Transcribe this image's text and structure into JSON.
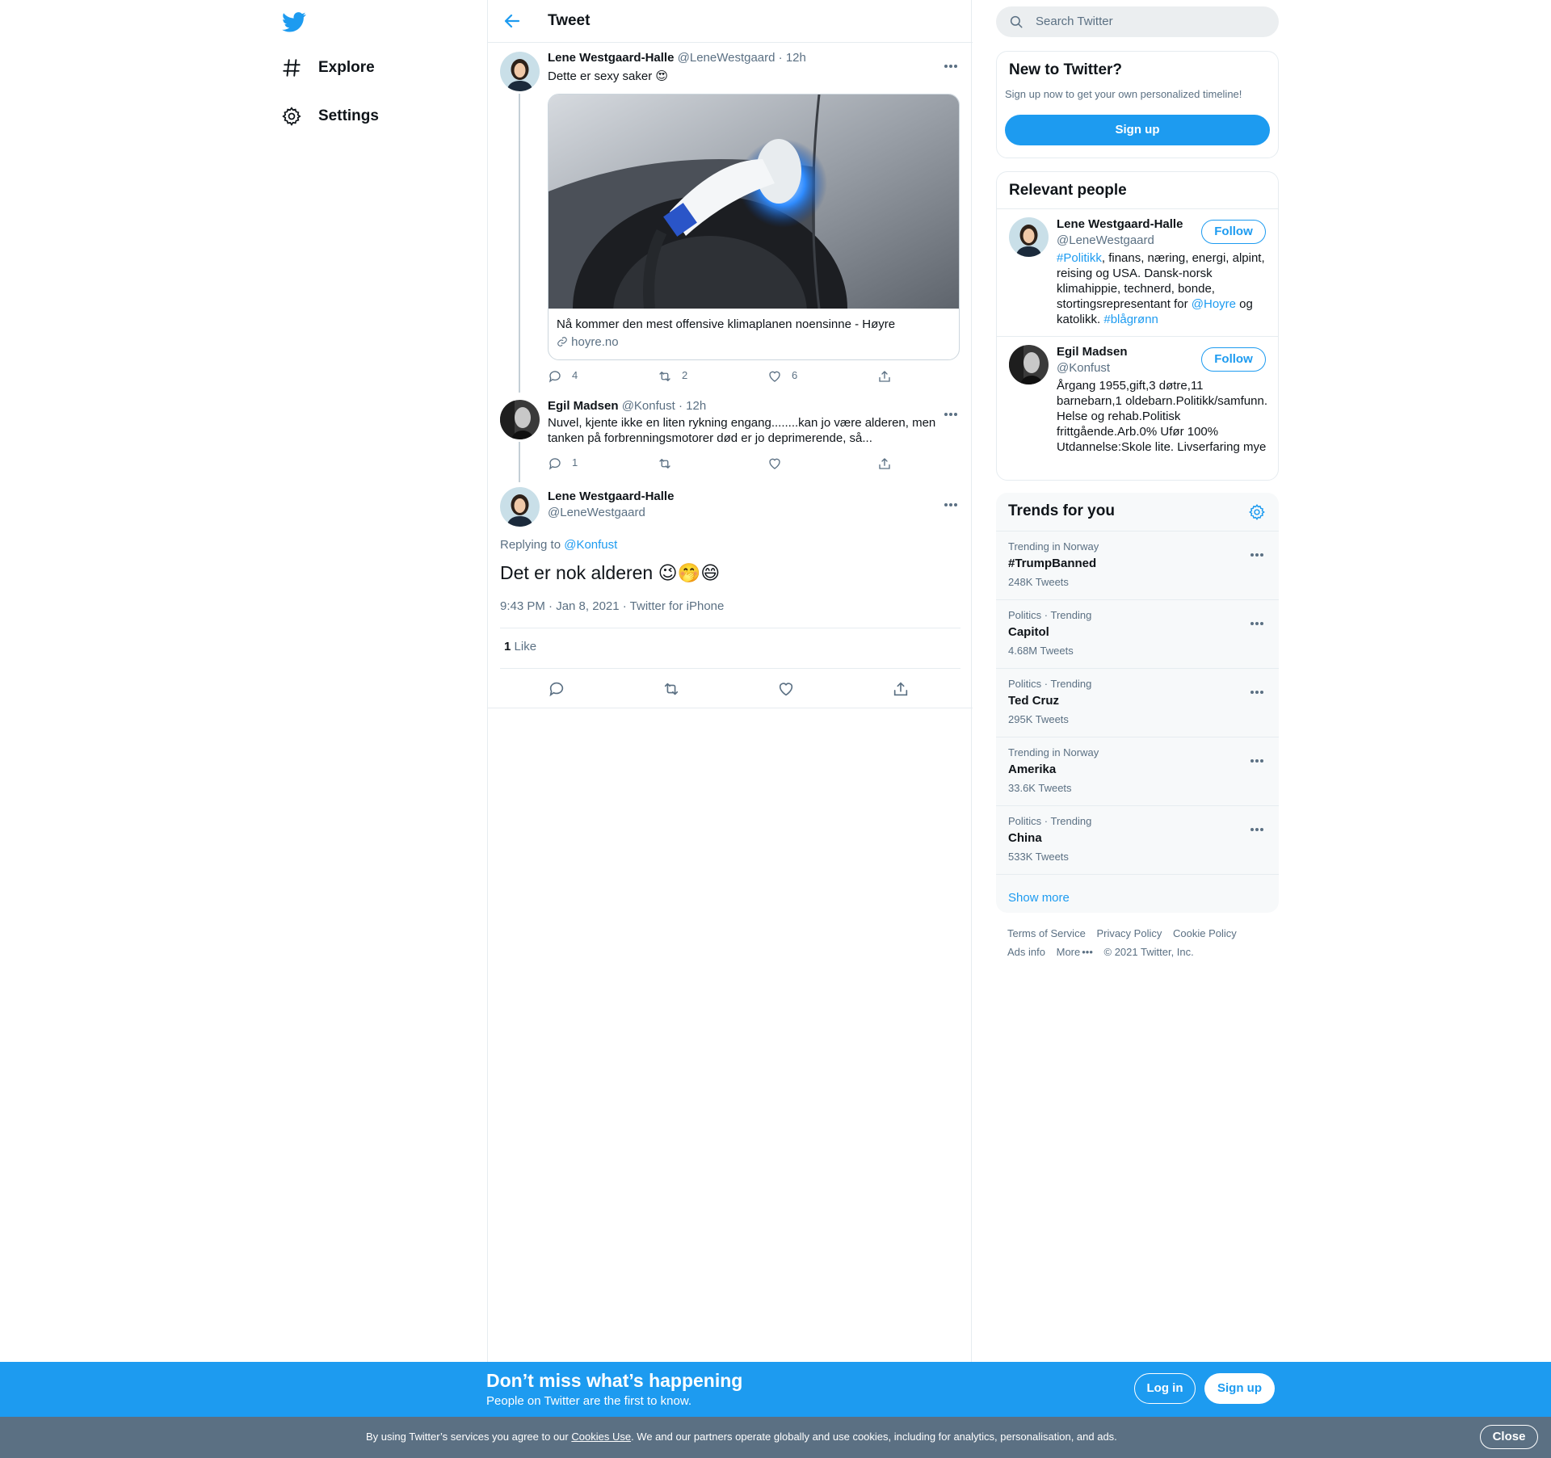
{
  "nav": {
    "explore_label": "Explore",
    "settings_label": "Settings"
  },
  "header": {
    "title": "Tweet"
  },
  "thread": [
    {
      "name": "Lene Westgaard-Halle",
      "handle": "@LeneWestgaard",
      "time": "· 12h",
      "text": "Dette er sexy saker",
      "emoji": "😍",
      "card": {
        "title": "Nå kommer den mest offensive klimaplanen noensinne - Høyre",
        "url": "hoyre.no"
      },
      "replies": "4",
      "retweets": "2",
      "likes": "6"
    },
    {
      "name": "Egil Madsen",
      "handle": "@Konfust",
      "time": "· 12h",
      "text": "Nuvel, kjente ikke en liten rykning engang........kan jo være alderen, men tanken på forbrenningsmotorer død er jo deprimerende, så...",
      "replies": "1",
      "retweets": "",
      "likes": ""
    }
  ],
  "focus": {
    "name": "Lene Westgaard-Halle",
    "handle": "@LeneWestgaard",
    "replying_prefix": "Replying to",
    "replying_to": "@Konfust",
    "text": "Det er nok alderen",
    "emojis": "😉🤭😄",
    "meta": "9:43 PM · Jan 8, 2021 · Twitter for iPhone",
    "like_count": "1",
    "like_label": "Like"
  },
  "sidebar": {
    "search_placeholder": "Search Twitter",
    "new": {
      "title": "New to Twitter?",
      "subtitle": "Sign up now to get your own personalized timeline!",
      "signup_label": "Sign up"
    },
    "relevant": {
      "title": "Relevant people",
      "follow_label": "Follow",
      "people": [
        {
          "name": "Lene Westgaard-Halle",
          "handle": "@LeneWestgaard",
          "bio_parts": [
            "#Politikk",
            ", finans, næring, energi, alpint, reising og USA. Dansk-norsk klimahippie, technerd, bonde, stortingsrepresentant for ",
            "@Hoyre",
            " og katolikk. ",
            "#blågrønn"
          ]
        },
        {
          "name": "Egil Madsen",
          "handle": "@Konfust",
          "bio": "Årgang 1955,gift,3 døtre,11 barnebarn,1 oldebarn.Politikk/samfunn. Helse og rehab.Politisk frittgående.Arb.0% Ufør 100% Utdannelse:Skole lite. Livserfaring mye"
        }
      ]
    },
    "trends": {
      "title": "Trends for you",
      "items": [
        {
          "context": "Trending in Norway",
          "name": "#TrumpBanned",
          "count": "248K Tweets"
        },
        {
          "context": "Politics · Trending",
          "name": "Capitol",
          "count": "4.68M Tweets"
        },
        {
          "context": "Politics · Trending",
          "name": "Ted Cruz",
          "count": "295K Tweets"
        },
        {
          "context": "Trending in Norway",
          "name": "Amerika",
          "count": "33.6K Tweets"
        },
        {
          "context": "Politics · Trending",
          "name": "China",
          "count": "533K Tweets"
        }
      ],
      "show_more": "Show more"
    },
    "footer": {
      "terms": "Terms of Service",
      "privacy": "Privacy Policy",
      "cookie": "Cookie Policy",
      "ads": "Ads info",
      "more": "More",
      "copyright": "© 2021 Twitter, Inc."
    }
  },
  "banner": {
    "title": "Don’t miss what’s happening",
    "subtitle": "People on Twitter are the first to know.",
    "login_label": "Log in",
    "signup_label": "Sign up"
  },
  "cookie": {
    "prefix": "By using Twitter’s services you agree to our",
    "link": "Cookies Use",
    "suffix": ". We and our partners operate globally and use cookies, including for analytics, personalisation, and ads.",
    "close_label": "Close"
  },
  "colors": {
    "accent": "#1d9bf0",
    "muted": "#5b7083",
    "cookie_bg": "#5b7083"
  }
}
